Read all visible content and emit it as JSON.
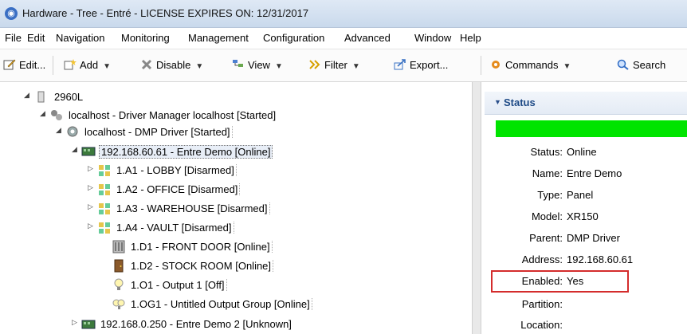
{
  "window": {
    "title": "Hardware - Tree - Entré - LICENSE EXPIRES ON: 12/31/2017"
  },
  "menu": [
    "File",
    "Edit",
    "Navigation",
    "Monitoring",
    "Management",
    "Configuration",
    "Advanced",
    "Window",
    "Help"
  ],
  "toolbar": {
    "edit": "Edit...",
    "add": "Add",
    "disable": "Disable",
    "view": "View",
    "filter": "Filter",
    "export": "Export...",
    "commands": "Commands",
    "search": "Search"
  },
  "tree": [
    "2960L",
    "localhost - Driver Manager localhost [Started]",
    "localhost - DMP Driver [Started]",
    "192.168.60.61 - Entre Demo [Online]",
    "1.A1 - LOBBY [Disarmed]",
    "1.A2 - OFFICE [Disarmed]",
    "1.A3 - WAREHOUSE [Disarmed]",
    "1.A4 - VAULT [Disarmed]",
    "1.D1 - FRONT DOOR [Online]",
    "1.D2 - STOCK ROOM [Online]",
    "1.O1 - Output 1 [Off]",
    "1.OG1 - Untitled Output Group [Online]",
    "192.168.0.250 - Entre Demo 2 [Unknown]"
  ],
  "status": {
    "title": "Status",
    "status_color": "#00e400",
    "props": [
      {
        "k": "Status:",
        "v": "Online"
      },
      {
        "k": "Name:",
        "v": "Entre Demo"
      },
      {
        "k": "Type:",
        "v": "Panel"
      },
      {
        "k": "Model:",
        "v": "XR150"
      },
      {
        "k": "Parent:",
        "v": "DMP Driver"
      },
      {
        "k": "Address:",
        "v": "192.168.60.61"
      },
      {
        "k": "Enabled:",
        "v": "Yes"
      },
      {
        "k": "Partition:",
        "v": ""
      },
      {
        "k": "Location:",
        "v": ""
      }
    ]
  }
}
